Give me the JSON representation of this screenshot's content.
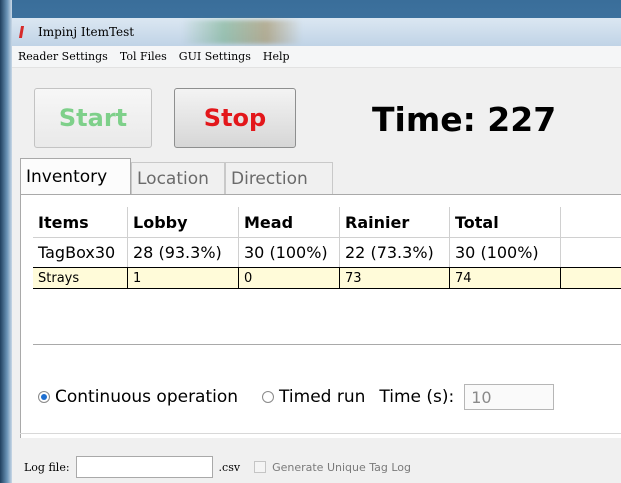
{
  "window": {
    "title": "Impinj ItemTest"
  },
  "menu": [
    "Reader Settings",
    "Tol Files",
    "GUI Settings",
    "Help"
  ],
  "controls": {
    "start_label": "Start",
    "stop_label": "Stop",
    "time_text": "Time: 227"
  },
  "tabs": [
    "Inventory",
    "Location",
    "Direction"
  ],
  "table": {
    "headers": [
      "Items",
      "Lobby",
      "Mead",
      "Rainier",
      "Total"
    ],
    "rows": [
      [
        "TagBox30",
        "28 (93.3%)",
        "30 (100%)",
        "22 (73.3%)",
        "30 (100%)"
      ],
      [
        "Strays",
        "1",
        "0",
        "73",
        "74"
      ]
    ]
  },
  "options": {
    "continuous_label": "Continuous operation",
    "timed_label": "Timed run",
    "time_s_label": "Time (s):",
    "time_s_value": "10",
    "selected": "continuous"
  },
  "log": {
    "label": "Log file:",
    "value": "",
    "suffix": ".csv",
    "unique_label": "Generate Unique Tag Log",
    "unique_checked": false
  },
  "colors": {
    "start": "#7ed08a",
    "stop": "#e3171b",
    "strays_bg": "#fffbd9"
  }
}
